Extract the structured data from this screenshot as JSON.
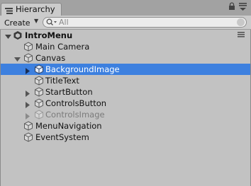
{
  "panel": {
    "tab_label": "Hierarchy"
  },
  "toolbar": {
    "create_label": "Create",
    "search_placeholder": "All"
  },
  "tree": {
    "scene_name": "IntroMenu",
    "items": [
      {
        "label": "Main Camera"
      },
      {
        "label": "Canvas"
      },
      {
        "label": "BackgroundImage"
      },
      {
        "label": "TitleText"
      },
      {
        "label": "StartButton"
      },
      {
        "label": "ControlsButton"
      },
      {
        "label": "ControlsImage"
      },
      {
        "label": "MenuNavigation"
      },
      {
        "label": "EventSystem"
      }
    ]
  },
  "colors": {
    "selection": "#3d80df",
    "panel_background": "#c2c2c2",
    "inactive_text": "#7b7b7b"
  }
}
